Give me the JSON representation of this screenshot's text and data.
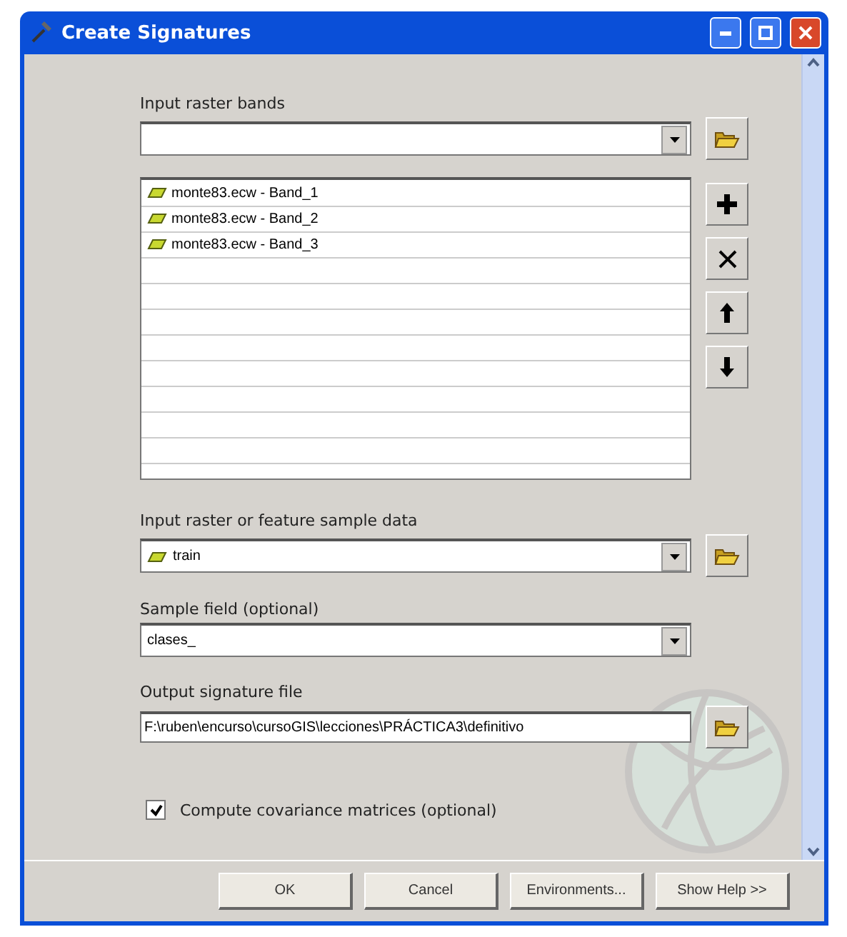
{
  "window": {
    "title": "Create Signatures"
  },
  "input_raster_bands": {
    "label": "Input raster bands",
    "items": [
      {
        "label": "monte83.ecw - Band_1"
      },
      {
        "label": "monte83.ecw - Band_2"
      },
      {
        "label": "monte83.ecw - Band_3"
      }
    ]
  },
  "sample_data": {
    "label": "Input raster or feature sample data",
    "value": "train"
  },
  "sample_field": {
    "label": "Sample field (optional)",
    "value": "clases_"
  },
  "output_file": {
    "label": "Output signature file",
    "value": "F:\\ruben\\encurso\\cursoGIS\\lecciones\\PRÁCTICA3\\definitivo"
  },
  "covariance": {
    "label": "Compute covariance matrices (optional)",
    "checked": true
  },
  "buttons": [
    "OK",
    "Cancel",
    "Environments...",
    "Show Help >>"
  ]
}
